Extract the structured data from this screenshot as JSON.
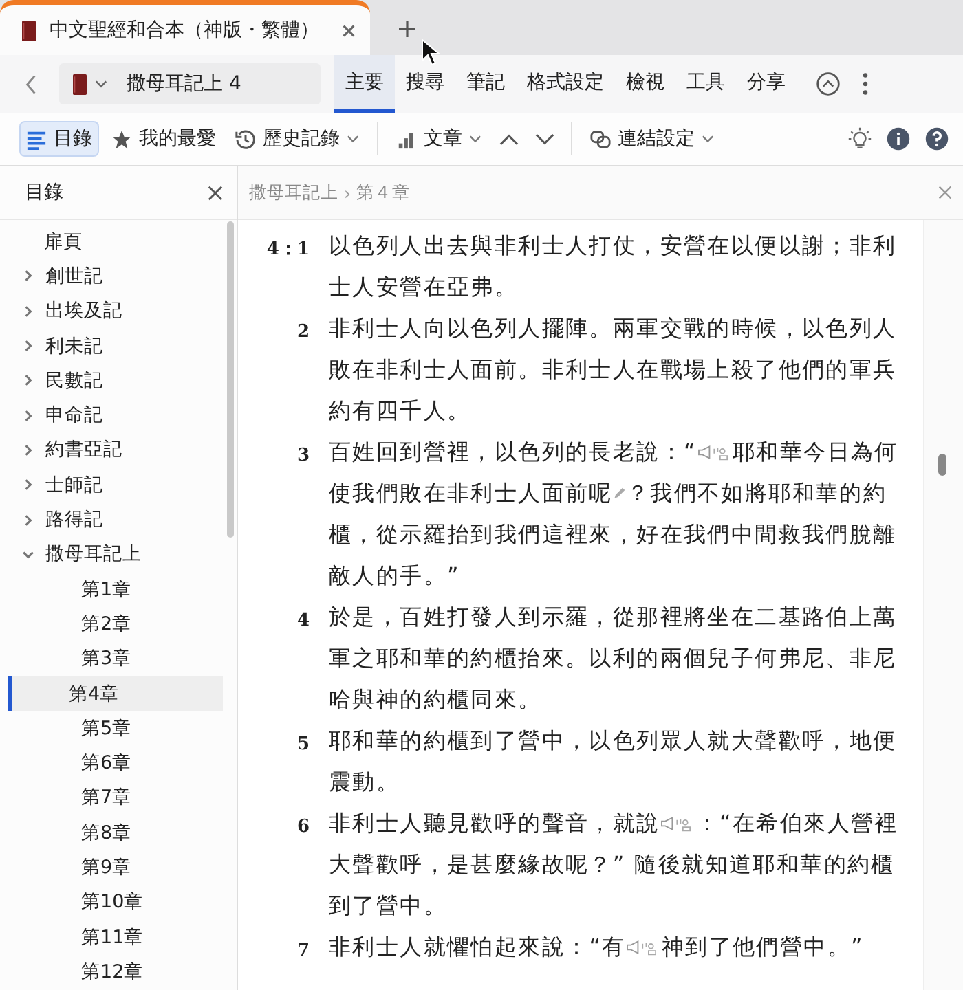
{
  "tabs": [
    {
      "title": "中文聖經和合本（神版・繁體）",
      "selected": true
    }
  ],
  "nav": {
    "book": "撒母耳記上 4"
  },
  "menu": [
    {
      "label": "主要",
      "selected": true
    },
    {
      "label": "搜尋",
      "selected": false
    },
    {
      "label": "筆記",
      "selected": false
    },
    {
      "label": "格式設定",
      "selected": false
    },
    {
      "label": "檢視",
      "selected": false
    },
    {
      "label": "工具",
      "selected": false
    },
    {
      "label": "分享",
      "selected": false
    }
  ],
  "toolbar": [
    {
      "kind": "toc",
      "label": "目錄",
      "selected": true,
      "dropdown": false
    },
    {
      "kind": "favorites",
      "label": "我的最愛",
      "selected": false,
      "dropdown": false
    },
    {
      "kind": "history",
      "label": "歷史記錄",
      "selected": false,
      "dropdown": true
    },
    {
      "kind": "article",
      "label": "文章",
      "selected": false,
      "dropdown": true
    },
    {
      "kind": "link",
      "label": "連結設定",
      "selected": false,
      "dropdown": true
    }
  ],
  "sidebar": {
    "title": "目錄",
    "items": [
      {
        "kind": "page",
        "label": "扉頁"
      },
      {
        "kind": "book",
        "label": "創世記",
        "expanded": false
      },
      {
        "kind": "book",
        "label": "出埃及記",
        "expanded": false
      },
      {
        "kind": "book",
        "label": "利未記",
        "expanded": false
      },
      {
        "kind": "book",
        "label": "民數記",
        "expanded": false
      },
      {
        "kind": "book",
        "label": "申命記",
        "expanded": false
      },
      {
        "kind": "book",
        "label": "約書亞記",
        "expanded": false
      },
      {
        "kind": "book",
        "label": "士師記",
        "expanded": false
      },
      {
        "kind": "book",
        "label": "路得記",
        "expanded": false
      },
      {
        "kind": "book",
        "label": "撒母耳記上",
        "expanded": true,
        "children": [
          {
            "label": "第1章",
            "selected": false
          },
          {
            "label": "第2章",
            "selected": false
          },
          {
            "label": "第3章",
            "selected": false
          },
          {
            "label": "第4章",
            "selected": true
          },
          {
            "label": "第5章",
            "selected": false
          },
          {
            "label": "第6章",
            "selected": false
          },
          {
            "label": "第7章",
            "selected": false
          },
          {
            "label": "第8章",
            "selected": false
          },
          {
            "label": "第9章",
            "selected": false
          },
          {
            "label": "第10章",
            "selected": false
          },
          {
            "label": "第11章",
            "selected": false
          },
          {
            "label": "第12章",
            "selected": false
          }
        ]
      }
    ]
  },
  "breadcrumb": {
    "separator": "›",
    "items": [
      "撒母耳記上",
      "第４章"
    ]
  },
  "verses": [
    {
      "number": "4：1",
      "parts": [
        {
          "kind": "text",
          "text": "以色列人出去與非利士人打仗，安營在以便以謝；非利士人安營在亞弗。"
        }
      ]
    },
    {
      "number": "2",
      "parts": [
        {
          "kind": "text",
          "text": "非利士人向以色列人擺陣。兩軍交戰的時候，以色列人敗在非利士人面前。非利士人在戰場上殺了他們的軍兵約有四千人。"
        }
      ]
    },
    {
      "number": "3",
      "parts": [
        {
          "kind": "text",
          "text": "百姓回到營裡，以色列的長老說：“"
        },
        {
          "kind": "speaker"
        },
        {
          "kind": "text",
          "text": "耶和華今日為何使我們敗在非利士人面前呢"
        },
        {
          "kind": "pencil"
        },
        {
          "kind": "text",
          "text": "？我們不如將耶和華的約櫃，從示羅抬到我們這裡來，好在我們中間救我們脫離敵人的手。”"
        }
      ]
    },
    {
      "number": "4",
      "parts": [
        {
          "kind": "text",
          "text": "於是，百姓打發人到示羅，從那裡將坐在二基路伯上萬軍之耶和華的約櫃抬來。以利的兩個兒子何弗尼、非尼哈與神的約櫃同來。"
        }
      ]
    },
    {
      "number": "5",
      "parts": [
        {
          "kind": "text",
          "text": "耶和華的約櫃到了營中，以色列眾人就大聲歡呼，地便震動。"
        }
      ]
    },
    {
      "number": "6",
      "parts": [
        {
          "kind": "text",
          "text": "非利士人聽見歡呼的聲音，就說"
        },
        {
          "kind": "speaker"
        },
        {
          "kind": "text",
          "text": "：“在希伯來人營裡大聲歡呼，是甚麼緣故呢？” 隨後就知道耶和華的約櫃到了營中。"
        }
      ]
    },
    {
      "number": "7",
      "parts": [
        {
          "kind": "text",
          "text": "非利士人就懼怕起來說：“有"
        },
        {
          "kind": "speaker"
        },
        {
          "kind": "text",
          "text": "神到了他們營中。”"
        }
      ]
    }
  ]
}
